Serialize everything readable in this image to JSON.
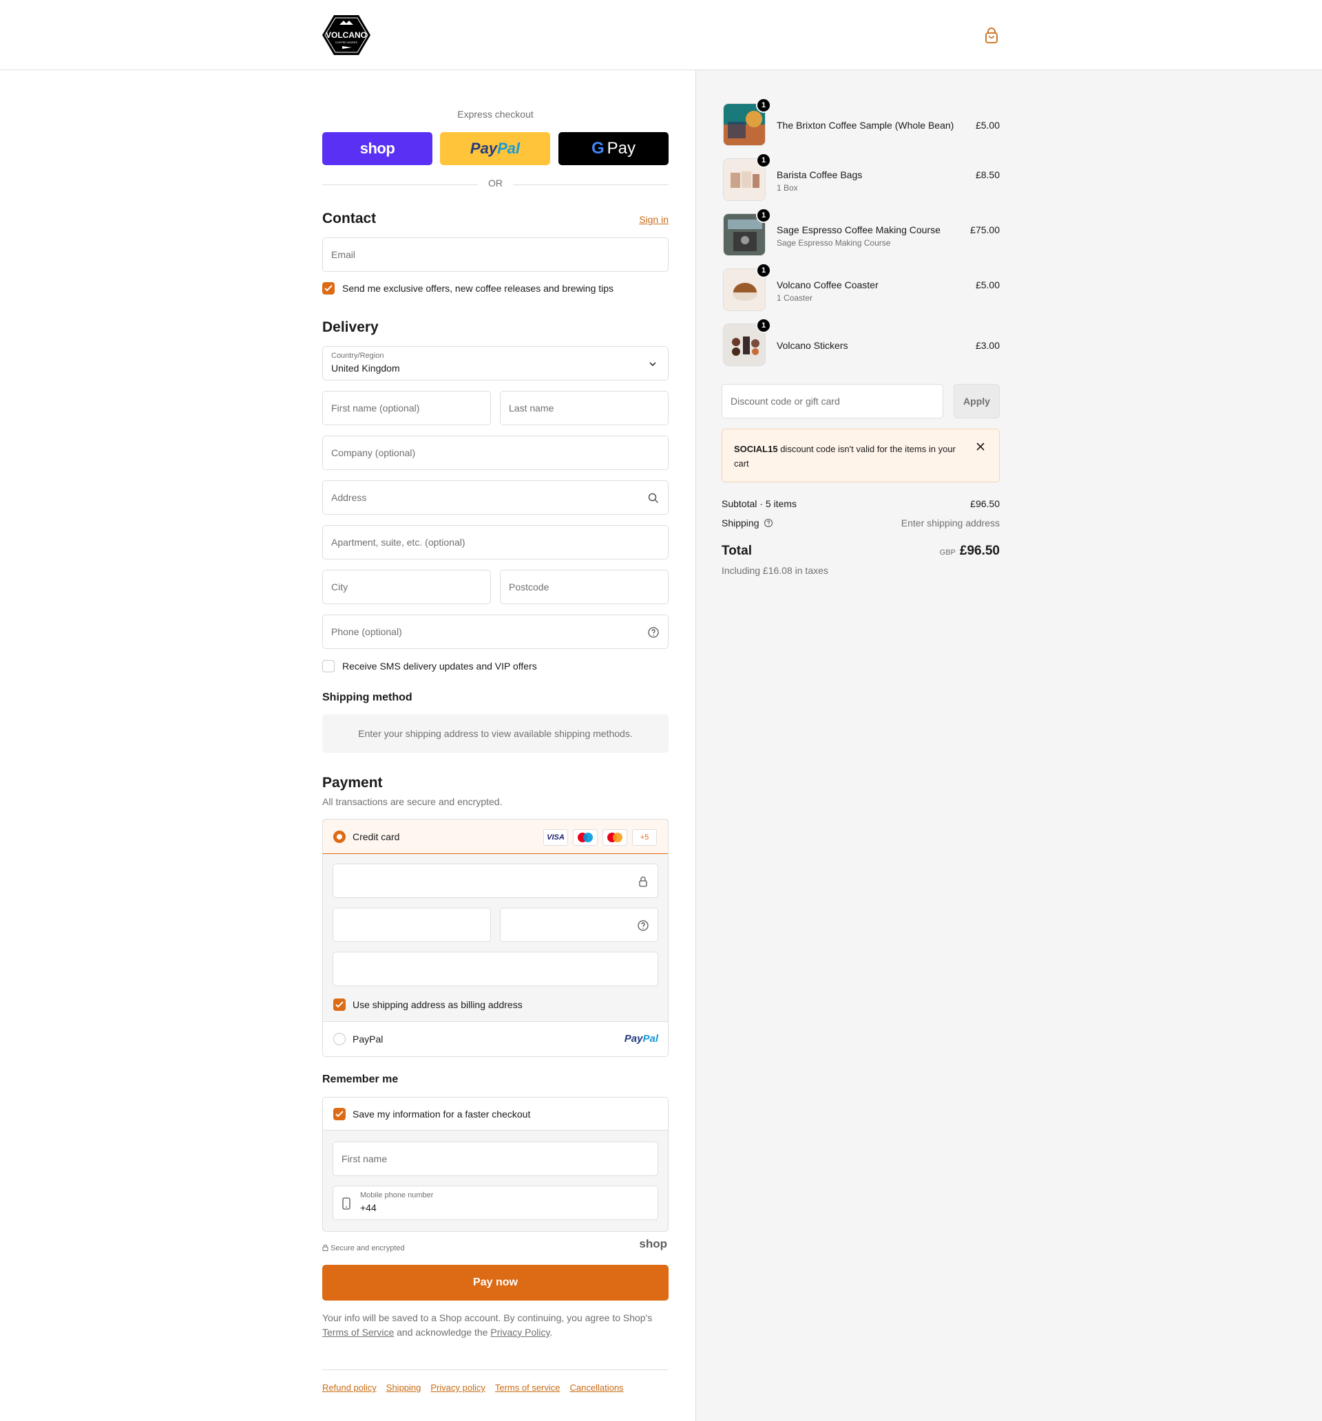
{
  "express": {
    "title": "Express checkout",
    "shop_label": "shop",
    "paypal_label_1": "Pay",
    "paypal_label_2": "Pal",
    "gpay_label": "Pay",
    "gpay_g": "G",
    "or_label": "OR"
  },
  "contact": {
    "title": "Contact",
    "sign_in": "Sign in",
    "email_placeholder": "Email",
    "offers_label": "Send me exclusive offers, new coffee releases and brewing tips"
  },
  "delivery": {
    "title": "Delivery",
    "country_label": "Country/Region",
    "country_value": "United Kingdom",
    "first_name": "First name (optional)",
    "last_name": "Last name",
    "company": "Company (optional)",
    "address": "Address",
    "apartment": "Apartment, suite, etc. (optional)",
    "city": "City",
    "postcode": "Postcode",
    "phone": "Phone (optional)",
    "sms_label": "Receive SMS delivery updates and VIP offers"
  },
  "shipping_method": {
    "title": "Shipping method",
    "notice": "Enter your shipping address to view available shipping methods."
  },
  "payment": {
    "title": "Payment",
    "subtitle": "All transactions are secure and encrypted.",
    "credit_card": "Credit card",
    "cards": [
      "VISA",
      "",
      "",
      "+5"
    ],
    "billing_label": "Use shipping address as billing address",
    "paypal_label": "PayPal",
    "paypal_logo_1": "Pay",
    "paypal_logo_2": "Pal"
  },
  "remember": {
    "title": "Remember me",
    "save_label": "Save my information for a faster checkout",
    "first_name": "First name",
    "mobile_label": "Mobile phone number",
    "mobile_value": "+44"
  },
  "secure": {
    "label": "Secure and encrypted",
    "shop_logo": "shop"
  },
  "pay_now": "Pay now",
  "legal": {
    "line1": "Your info will be saved to a Shop account. By continuing, you agree to Shop's",
    "terms": "Terms of Service",
    "mid": "and acknowledge the",
    "privacy": "Privacy Policy",
    "end": "."
  },
  "footer": [
    "Refund policy",
    "Shipping",
    "Privacy policy",
    "Terms of service",
    "Cancellations"
  ],
  "cart": {
    "items": [
      {
        "name": "The Brixton Coffee Sample (Whole Bean)",
        "sub": "",
        "price": "£5.00",
        "qty": "1"
      },
      {
        "name": "Barista Coffee Bags",
        "sub": "1 Box",
        "price": "£8.50",
        "qty": "1"
      },
      {
        "name": "Sage Espresso Coffee Making Course",
        "sub": "Sage Espresso Making Course",
        "price": "£75.00",
        "qty": "1"
      },
      {
        "name": "Volcano Coffee Coaster",
        "sub": "1 Coaster",
        "price": "£5.00",
        "qty": "1"
      },
      {
        "name": "Volcano Stickers",
        "sub": "",
        "price": "£3.00",
        "qty": "1"
      }
    ],
    "discount_placeholder": "Discount code or gift card",
    "apply": "Apply",
    "error_code": "SOCIAL15",
    "error_text": "discount code isn't valid for the items in your cart",
    "subtotal_label": "Subtotal · 5 items",
    "subtotal_value": "£96.50",
    "shipping_label": "Shipping",
    "shipping_value": "Enter shipping address",
    "total_label": "Total",
    "currency": "GBP",
    "total_value": "£96.50",
    "taxes": "Including £16.08 in taxes"
  },
  "logo_text": "VOLCANO",
  "colors": {
    "accent": "#dd6a14",
    "shop": "#5a31f4",
    "paypal": "#ffc439"
  }
}
